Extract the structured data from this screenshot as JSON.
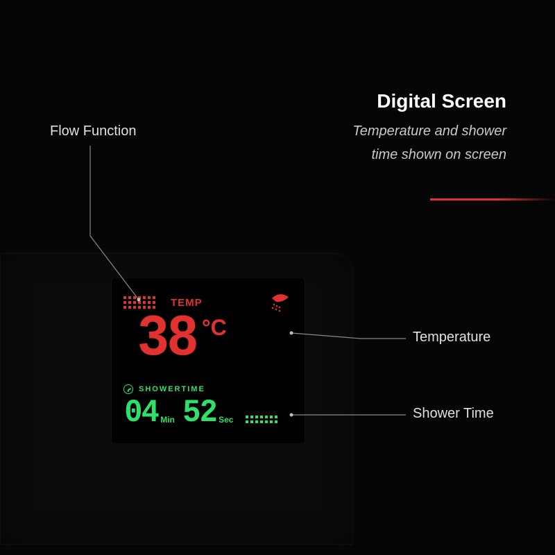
{
  "header": {
    "title": "Digital Screen",
    "subtitle_line1": "Temperature and shower",
    "subtitle_line2": "time shown on screen"
  },
  "callouts": {
    "flow": "Flow Function",
    "temperature": "Temperature",
    "shower_time": "Shower Time"
  },
  "screen": {
    "temp_label": "TEMP",
    "temp_value": "38",
    "temp_unit": "°C",
    "showertime_label": "SHOWERTIME",
    "minutes": "04",
    "minutes_suffix": "Min",
    "seconds": "52",
    "seconds_suffix": "Sec"
  },
  "colors": {
    "red": "#e0322f",
    "green": "#2fe06a",
    "accent": "#e0322f"
  }
}
